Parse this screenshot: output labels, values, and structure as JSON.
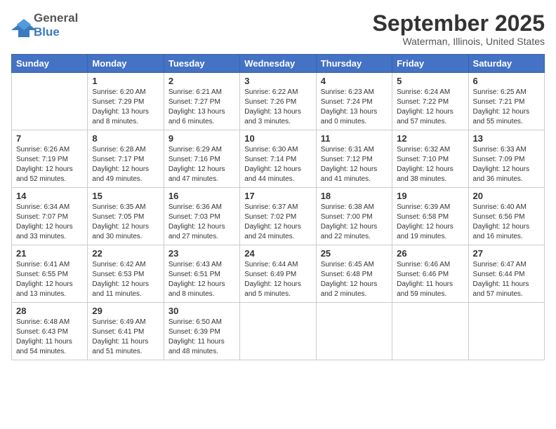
{
  "header": {
    "logo_general": "General",
    "logo_blue": "Blue",
    "title": "September 2025",
    "location": "Waterman, Illinois, United States"
  },
  "columns": [
    "Sunday",
    "Monday",
    "Tuesday",
    "Wednesday",
    "Thursday",
    "Friday",
    "Saturday"
  ],
  "weeks": [
    [
      {
        "day": "",
        "info": ""
      },
      {
        "day": "1",
        "info": "Sunrise: 6:20 AM\nSunset: 7:29 PM\nDaylight: 13 hours\nand 8 minutes."
      },
      {
        "day": "2",
        "info": "Sunrise: 6:21 AM\nSunset: 7:27 PM\nDaylight: 13 hours\nand 6 minutes."
      },
      {
        "day": "3",
        "info": "Sunrise: 6:22 AM\nSunset: 7:26 PM\nDaylight: 13 hours\nand 3 minutes."
      },
      {
        "day": "4",
        "info": "Sunrise: 6:23 AM\nSunset: 7:24 PM\nDaylight: 13 hours\nand 0 minutes."
      },
      {
        "day": "5",
        "info": "Sunrise: 6:24 AM\nSunset: 7:22 PM\nDaylight: 12 hours\nand 57 minutes."
      },
      {
        "day": "6",
        "info": "Sunrise: 6:25 AM\nSunset: 7:21 PM\nDaylight: 12 hours\nand 55 minutes."
      }
    ],
    [
      {
        "day": "7",
        "info": "Sunrise: 6:26 AM\nSunset: 7:19 PM\nDaylight: 12 hours\nand 52 minutes."
      },
      {
        "day": "8",
        "info": "Sunrise: 6:28 AM\nSunset: 7:17 PM\nDaylight: 12 hours\nand 49 minutes."
      },
      {
        "day": "9",
        "info": "Sunrise: 6:29 AM\nSunset: 7:16 PM\nDaylight: 12 hours\nand 47 minutes."
      },
      {
        "day": "10",
        "info": "Sunrise: 6:30 AM\nSunset: 7:14 PM\nDaylight: 12 hours\nand 44 minutes."
      },
      {
        "day": "11",
        "info": "Sunrise: 6:31 AM\nSunset: 7:12 PM\nDaylight: 12 hours\nand 41 minutes."
      },
      {
        "day": "12",
        "info": "Sunrise: 6:32 AM\nSunset: 7:10 PM\nDaylight: 12 hours\nand 38 minutes."
      },
      {
        "day": "13",
        "info": "Sunrise: 6:33 AM\nSunset: 7:09 PM\nDaylight: 12 hours\nand 36 minutes."
      }
    ],
    [
      {
        "day": "14",
        "info": "Sunrise: 6:34 AM\nSunset: 7:07 PM\nDaylight: 12 hours\nand 33 minutes."
      },
      {
        "day": "15",
        "info": "Sunrise: 6:35 AM\nSunset: 7:05 PM\nDaylight: 12 hours\nand 30 minutes."
      },
      {
        "day": "16",
        "info": "Sunrise: 6:36 AM\nSunset: 7:03 PM\nDaylight: 12 hours\nand 27 minutes."
      },
      {
        "day": "17",
        "info": "Sunrise: 6:37 AM\nSunset: 7:02 PM\nDaylight: 12 hours\nand 24 minutes."
      },
      {
        "day": "18",
        "info": "Sunrise: 6:38 AM\nSunset: 7:00 PM\nDaylight: 12 hours\nand 22 minutes."
      },
      {
        "day": "19",
        "info": "Sunrise: 6:39 AM\nSunset: 6:58 PM\nDaylight: 12 hours\nand 19 minutes."
      },
      {
        "day": "20",
        "info": "Sunrise: 6:40 AM\nSunset: 6:56 PM\nDaylight: 12 hours\nand 16 minutes."
      }
    ],
    [
      {
        "day": "21",
        "info": "Sunrise: 6:41 AM\nSunset: 6:55 PM\nDaylight: 12 hours\nand 13 minutes."
      },
      {
        "day": "22",
        "info": "Sunrise: 6:42 AM\nSunset: 6:53 PM\nDaylight: 12 hours\nand 11 minutes."
      },
      {
        "day": "23",
        "info": "Sunrise: 6:43 AM\nSunset: 6:51 PM\nDaylight: 12 hours\nand 8 minutes."
      },
      {
        "day": "24",
        "info": "Sunrise: 6:44 AM\nSunset: 6:49 PM\nDaylight: 12 hours\nand 5 minutes."
      },
      {
        "day": "25",
        "info": "Sunrise: 6:45 AM\nSunset: 6:48 PM\nDaylight: 12 hours\nand 2 minutes."
      },
      {
        "day": "26",
        "info": "Sunrise: 6:46 AM\nSunset: 6:46 PM\nDaylight: 11 hours\nand 59 minutes."
      },
      {
        "day": "27",
        "info": "Sunrise: 6:47 AM\nSunset: 6:44 PM\nDaylight: 11 hours\nand 57 minutes."
      }
    ],
    [
      {
        "day": "28",
        "info": "Sunrise: 6:48 AM\nSunset: 6:43 PM\nDaylight: 11 hours\nand 54 minutes."
      },
      {
        "day": "29",
        "info": "Sunrise: 6:49 AM\nSunset: 6:41 PM\nDaylight: 11 hours\nand 51 minutes."
      },
      {
        "day": "30",
        "info": "Sunrise: 6:50 AM\nSunset: 6:39 PM\nDaylight: 11 hours\nand 48 minutes."
      },
      {
        "day": "",
        "info": ""
      },
      {
        "day": "",
        "info": ""
      },
      {
        "day": "",
        "info": ""
      },
      {
        "day": "",
        "info": ""
      }
    ]
  ]
}
